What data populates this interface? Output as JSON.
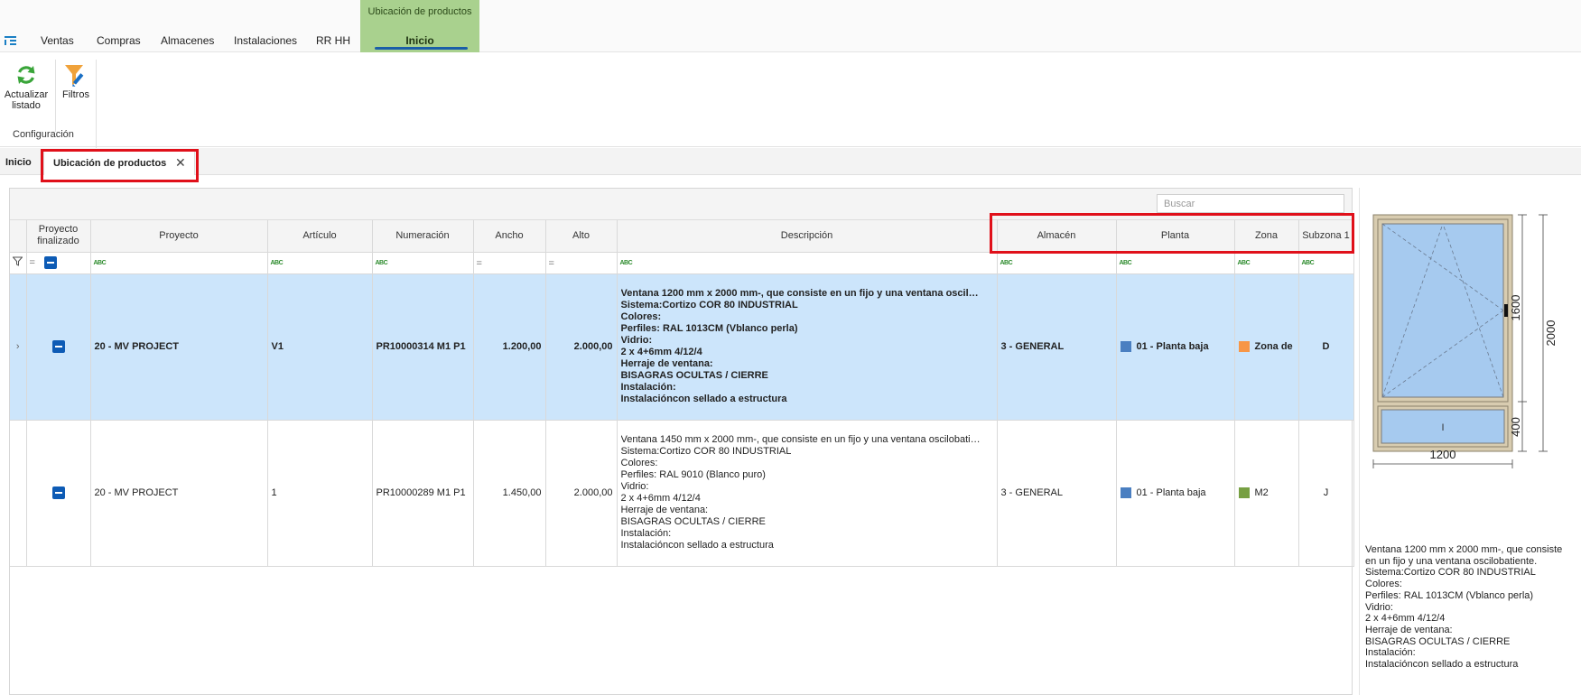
{
  "menu": {
    "items": [
      "Ventas",
      "Compras",
      "Almacenes",
      "Instalaciones",
      "RR HH"
    ],
    "context_group": "Ubicación de productos",
    "active_tab": "Inicio"
  },
  "ribbon": {
    "refresh_label_1": "Actualizar",
    "refresh_label_2": "listado",
    "filters_label": "Filtros",
    "group_label": "Configuración"
  },
  "doc_tabs": {
    "home": "Inicio",
    "active": "Ubicación de productos",
    "close_symbol": "✕"
  },
  "grid": {
    "search_placeholder": "Buscar",
    "columns": {
      "finalizado_1": "Proyecto",
      "finalizado_2": "finalizado",
      "proyecto": "Proyecto",
      "articulo": "Artículo",
      "numeracion": "Numeración",
      "ancho": "Ancho",
      "alto": "Alto",
      "descripcion": "Descripción",
      "almacen": "Almacén",
      "planta": "Planta",
      "zona": "Zona",
      "subzona": "Subzona 1"
    },
    "rows": [
      {
        "selected": true,
        "finalizado": true,
        "proyecto": "20 - MV PROJECT",
        "articulo": "V1",
        "numeracion": "PR10000314 M1 P1",
        "ancho": "1.200,00",
        "alto": "2.000,00",
        "descripcion": [
          "Ventana 1200 mm x 2000 mm-, que consiste en un fijo y una ventana oscil…",
          "Sistema:Cortizo COR 80 INDUSTRIAL",
          "Colores:",
          "Perfiles: RAL 1013CM (Vblanco perla)",
          "Vidrio:",
          "2 x 4+6mm 4/12/4",
          "Herraje de ventana:",
          "BISAGRAS OCULTAS / CIERRE",
          "Instalación:",
          "Instalacióncon sellado a estructura"
        ],
        "almacen": "3 - GENERAL",
        "planta": "01 - Planta baja",
        "planta_color": "#4a7fc1",
        "zona": "Zona de",
        "zona_color": "#f79646",
        "subzona": "D"
      },
      {
        "selected": false,
        "finalizado": true,
        "proyecto": "20 - MV PROJECT",
        "articulo": "1",
        "numeracion": "PR10000289 M1 P1",
        "ancho": "1.450,00",
        "alto": "2.000,00",
        "descripcion": [
          "Ventana 1450 mm x 2000 mm-, que consiste en un fijo y una ventana oscilobati…",
          "Sistema:Cortizo COR 80 INDUSTRIAL",
          "Colores:",
          "Perfiles: RAL 9010 (Blanco puro)",
          "Vidrio:",
          "2 x 4+6mm 4/12/4",
          "Herraje de ventana:",
          "BISAGRAS OCULTAS / CIERRE",
          "Instalación:",
          "Instalacióncon sellado a estructura"
        ],
        "almacen": "3 - GENERAL",
        "planta": "01 - Planta baja",
        "planta_color": "#4a7fc1",
        "zona": "M2",
        "zona_color": "#77a043",
        "subzona": "J"
      }
    ]
  },
  "preview": {
    "dim_width": "1200",
    "dim_height_total": "2000",
    "dim_height_top": "1600",
    "dim_height_bottom": "400",
    "fixed_mark": "I",
    "frame_color": "#d8ccb0",
    "glass_color": "#a6caef",
    "description": [
      "Ventana 1200 mm x 2000 mm-, que consiste",
      "en un fijo y una ventana oscilobatiente.",
      "Sistema:Cortizo COR 80 INDUSTRIAL",
      "Colores:",
      "Perfiles: RAL 1013CM (Vblanco perla)",
      "Vidrio:",
      "2 x 4+6mm 4/12/4",
      "Herraje de ventana:",
      "BISAGRAS OCULTAS / CIERRE",
      "Instalación:",
      "Instalacióncon sellado a estructura"
    ]
  },
  "highlight_color": "#e0101a",
  "accent_color": "#0d5bb5",
  "context_tab_color": "#a9d18e",
  "selected_row_color": "#cce5fb"
}
